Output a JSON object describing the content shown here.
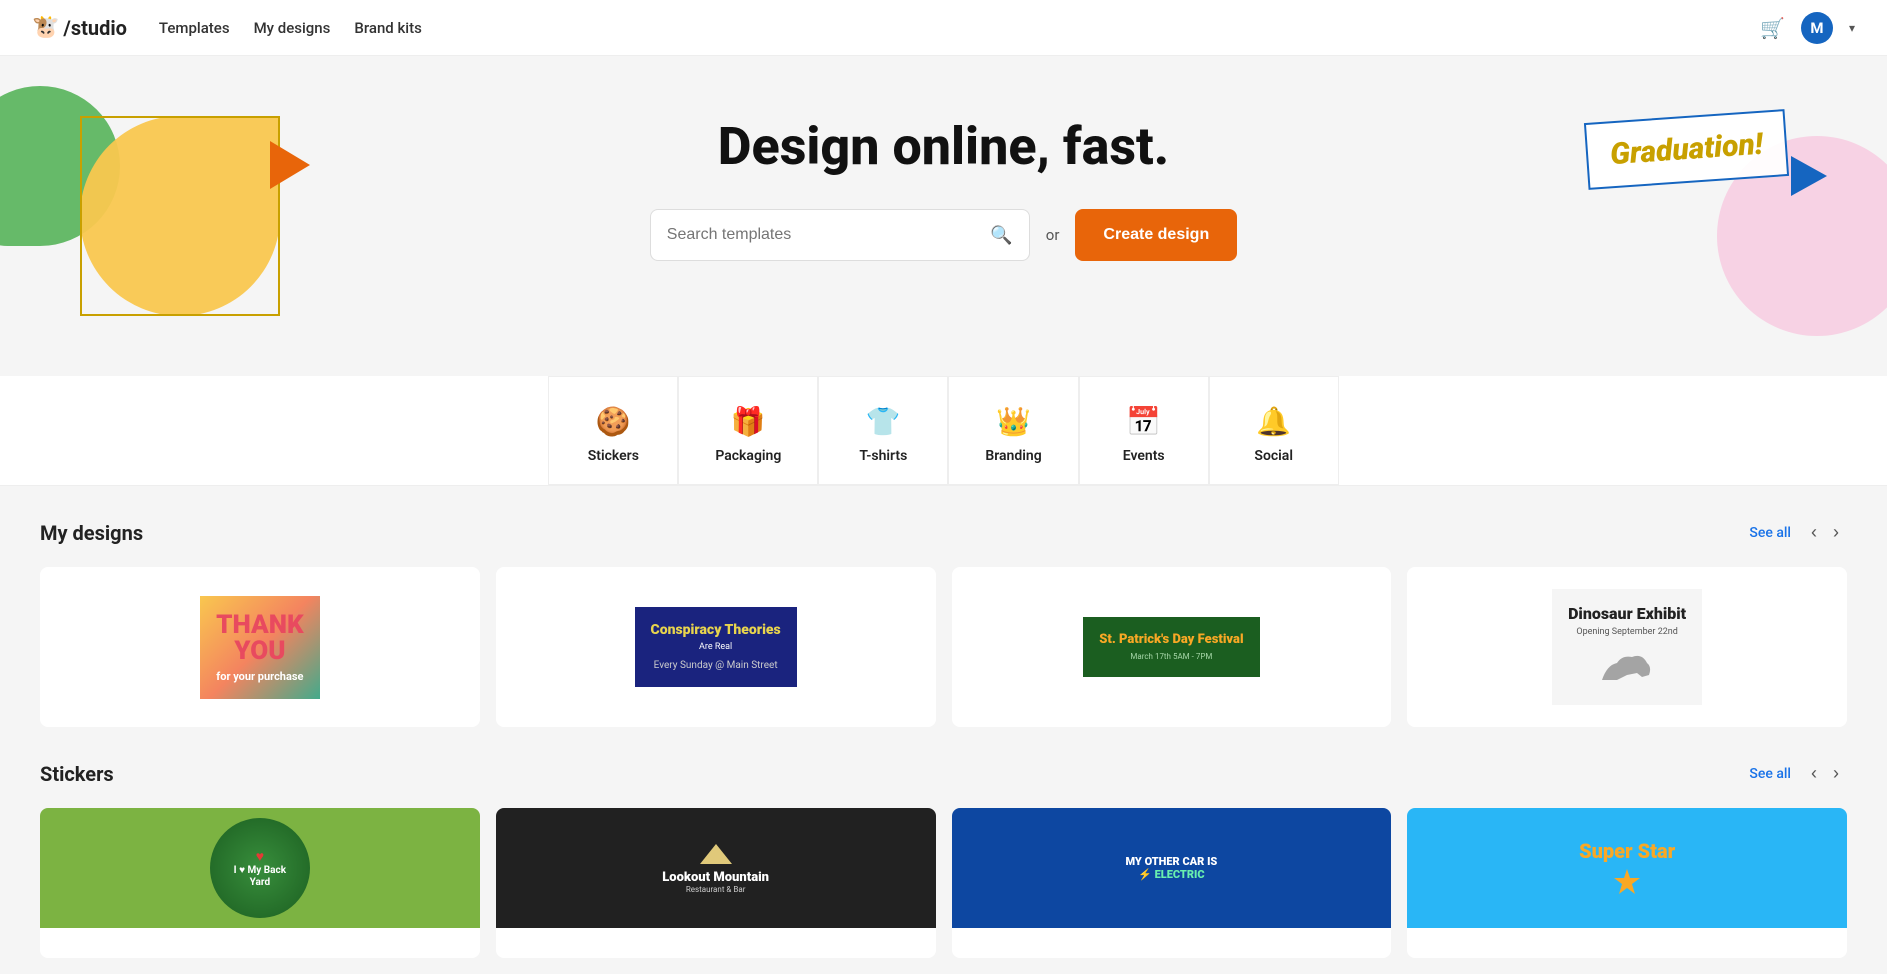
{
  "navbar": {
    "logo_icon": "🐮",
    "logo_text": "/studio",
    "nav_items": [
      "Templates",
      "My designs",
      "Brand kits"
    ],
    "cart_icon": "🛒",
    "avatar_initial": "M",
    "avatar_dropdown": "▾"
  },
  "hero": {
    "title": "Design online, fast.",
    "search_placeholder": "Search templates",
    "or_label": "or",
    "create_button": "Create design"
  },
  "categories": [
    {
      "icon": "🍪",
      "label": "Stickers"
    },
    {
      "icon": "🎁",
      "label": "Packaging"
    },
    {
      "icon": "👕",
      "label": "T-shirts"
    },
    {
      "icon": "👑",
      "label": "Branding"
    },
    {
      "icon": "📅",
      "label": "Events"
    },
    {
      "icon": "🔔",
      "label": "Social"
    }
  ],
  "my_designs": {
    "section_title": "My designs",
    "see_all_label": "See all",
    "prev_label": "‹",
    "next_label": "›",
    "cards": [
      {
        "id": "thankyou",
        "title": "Thank You",
        "subtitle": "for your purchase"
      },
      {
        "id": "conspiracy",
        "title": "Conspiracy Theories",
        "subtitle": "Are Real",
        "detail": "Every Sunday @ Main Street"
      },
      {
        "id": "stpatrick",
        "title": "St. Patrick's Day Festival",
        "subtitle": "March 17th 5AM - 7PM"
      },
      {
        "id": "dinosaur",
        "title": "Dinosaur Exhibit",
        "subtitle": "Opening September 22nd"
      }
    ]
  },
  "stickers": {
    "section_title": "Stickers",
    "see_all_label": "See all",
    "prev_label": "‹",
    "next_label": "›",
    "cards": [
      {
        "id": "backyard",
        "title": "I ♥ My Back Yard"
      },
      {
        "id": "mountain",
        "title": "Lookout Mountain",
        "subtitle": "Restaurant & Bar"
      },
      {
        "id": "electric",
        "title": "My Other Car Is Electric"
      },
      {
        "id": "superstar",
        "title": "Super Star"
      }
    ]
  },
  "deco": {
    "graduation_text": "Graduation!"
  }
}
